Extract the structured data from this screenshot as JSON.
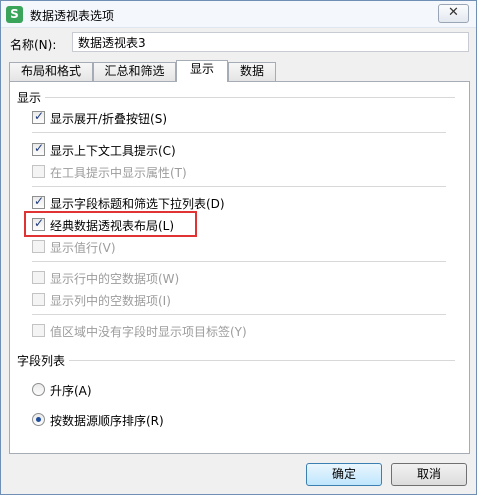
{
  "window": {
    "title": "数据透视表选项",
    "icon_glyph": "S",
    "close_glyph": "✕"
  },
  "name_field": {
    "label": "名称(N):",
    "value": "数据透视表3"
  },
  "tabs": [
    {
      "label": "布局和格式",
      "active": false
    },
    {
      "label": "汇总和筛选",
      "active": false
    },
    {
      "label": "显示",
      "active": true
    },
    {
      "label": "数据",
      "active": false
    }
  ],
  "display_section": {
    "title": "显示",
    "options": {
      "expand_collapse": {
        "label": "显示展开/折叠按钮(S)",
        "checked": true,
        "enabled": true
      },
      "tooltips": {
        "label": "显示上下文工具提示(C)",
        "checked": true,
        "enabled": true
      },
      "properties_in_tooltips": {
        "label": "在工具提示中显示属性(T)",
        "checked": false,
        "enabled": false
      },
      "field_captions": {
        "label": "显示字段标题和筛选下拉列表(D)",
        "checked": true,
        "enabled": true
      },
      "classic_layout": {
        "label": "经典数据透视表布局(L)",
        "checked": true,
        "enabled": true
      },
      "value_row": {
        "label": "显示值行(V)",
        "checked": false,
        "enabled": false
      },
      "empty_rows": {
        "label": "显示行中的空数据项(W)",
        "checked": false,
        "enabled": false
      },
      "empty_cols": {
        "label": "显示列中的空数据项(I)",
        "checked": false,
        "enabled": false
      },
      "item_labels": {
        "label": "值区域中没有字段时显示项目标签(Y)",
        "checked": false,
        "enabled": false
      }
    }
  },
  "field_list_section": {
    "title": "字段列表",
    "options": {
      "ascending": {
        "label": "升序(A)",
        "selected": false
      },
      "source_order": {
        "label": "按数据源顺序排序(R)",
        "selected": true
      }
    }
  },
  "buttons": {
    "ok": "确定",
    "cancel": "取消"
  },
  "colors": {
    "highlight_border": "#e03434",
    "window_border": "#6f8fb4"
  }
}
